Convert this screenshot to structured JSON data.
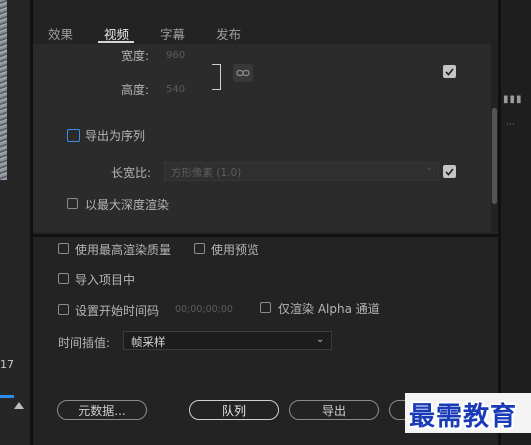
{
  "tabs": [
    "效果",
    "视频",
    "字幕",
    "发布"
  ],
  "video": {
    "width_label": "宽度:",
    "width_value": "960",
    "height_label": "高度:",
    "height_value": "540",
    "export_sequence_label": "导出为序列",
    "aspect_label": "长宽比:",
    "aspect_value": "方形像素 (1.0)",
    "max_depth_label": "以最大深度渲染"
  },
  "options": {
    "max_quality_label": "使用最高渲染质量",
    "use_preview_label": "使用预览",
    "import_project_label": "导入项目中",
    "set_start_timecode_label": "设置开始时间码",
    "start_timecode_value": "00;00;00;00",
    "render_alpha_label": "仅渲染 Alpha 通道",
    "time_interp_label": "时间插值:",
    "time_interp_value": "帧采样"
  },
  "buttons": {
    "metadata": "元数据...",
    "queue": "队列",
    "export": "导出"
  },
  "background": {
    "left_number": "17"
  },
  "watermark": "最需教育",
  "colors": {
    "accent_blue": "#3b8ee6",
    "watermark_blue": "#1a3bb8"
  }
}
